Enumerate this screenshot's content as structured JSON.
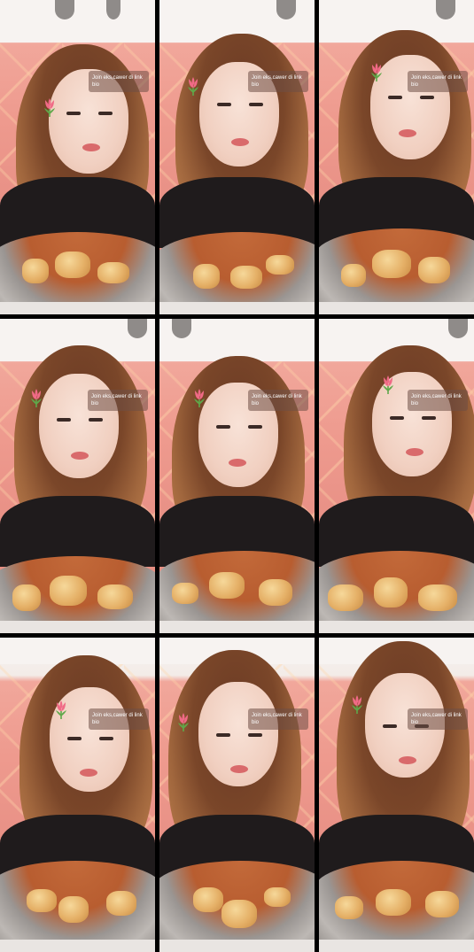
{
  "grid": {
    "frames": [
      {
        "caption": "Join eks,cawer di link bio",
        "sticker": "tulip-sticker-icon"
      },
      {
        "caption": "Join eks,cawer di link bio",
        "sticker": "tulip-sticker-icon"
      },
      {
        "caption": "Join eks,cawer di link bio",
        "sticker": "tulip-sticker-icon"
      },
      {
        "caption": "Join eks,cawer di link bio",
        "sticker": "tulip-sticker-icon"
      },
      {
        "caption": "Join eks,cawer di link bio",
        "sticker": "tulip-sticker-icon"
      },
      {
        "caption": "Join eks,cawer di link bio",
        "sticker": "tulip-sticker-icon"
      },
      {
        "caption": "Join eks,cawer di link bio",
        "sticker": "tulip-sticker-icon"
      },
      {
        "caption": "Join eks,cawer di link bio",
        "sticker": "tulip-sticker-icon"
      },
      {
        "caption": "Join eks,cawer di link bio",
        "sticker": "tulip-sticker-icon"
      }
    ]
  },
  "colors": {
    "wall": "#ee9a8e",
    "top_strip": "#f7f3f1",
    "hair": "#7a4629",
    "shirt": "#1f1b1c",
    "broth": "#b85d30",
    "tulip_petal": "#f06a86",
    "tulip_leaf": "#5fa84a"
  }
}
